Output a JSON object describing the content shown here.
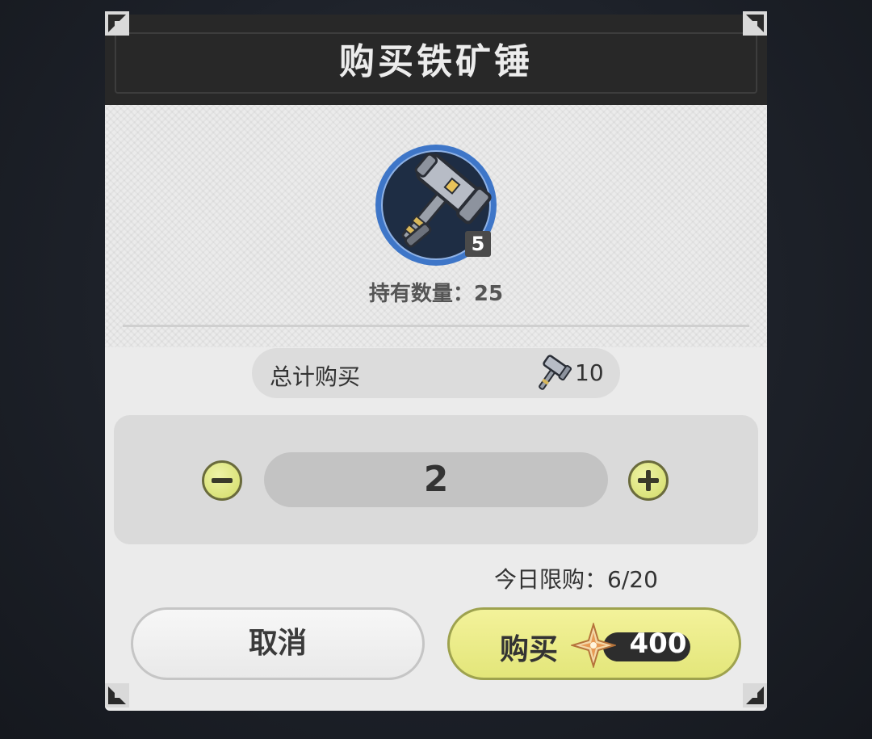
{
  "dialog": {
    "title": "购买铁矿锤"
  },
  "item": {
    "icon": "iron-hammer-icon",
    "badge": "5",
    "owned_text": "持有数量：25"
  },
  "total": {
    "label": "总计购买",
    "icon": "iron-hammer-icon",
    "value": "10"
  },
  "quantity": {
    "value": "2",
    "minus_icon": "minus-icon",
    "plus_icon": "plus-icon"
  },
  "limit": {
    "text": "今日限购：6/20"
  },
  "buttons": {
    "cancel_label": "取消",
    "buy_label": "购买",
    "price": "400",
    "currency_icon": "crystal-star-icon"
  },
  "colors": {
    "accent_yellow": "#e3e67a",
    "header_dark": "#282828",
    "item_ring_blue": "#3e76c8"
  }
}
